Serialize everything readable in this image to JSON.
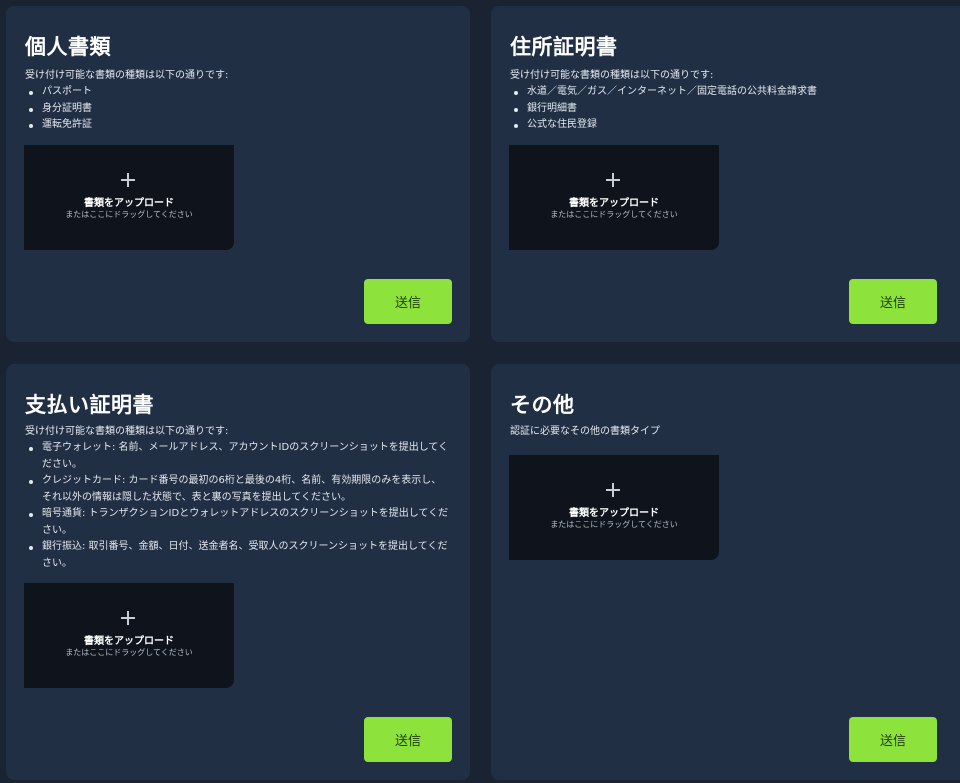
{
  "cards": {
    "personal": {
      "title": "個人書類",
      "description": "受け付け可能な書類の種類は以下の通りです:",
      "items": [
        "パスポート",
        "身分証明書",
        "運転免許証"
      ]
    },
    "address": {
      "title": "住所証明書",
      "description": "受け付け可能な書類の種類は以下の通りです:",
      "items": [
        "水道／電気／ガス／インターネット／固定電話の公共料金請求書",
        "銀行明細書",
        "公式な住民登録"
      ]
    },
    "payment": {
      "title": "支払い証明書",
      "description": "受け付け可能な書類の種類は以下の通りです:",
      "items": [
        "電子ウォレット: 名前、メールアドレス、アカウントIDのスクリーンショットを提出してください。",
        "クレジットカード: カード番号の最初の6桁と最後の4桁、名前、有効期限のみを表示し、それ以外の情報は隠した状態で、表と裏の写真を提出してください。",
        "暗号通貨: トランザクションIDとウォレットアドレスのスクリーンショットを提出してください。",
        "銀行振込: 取引番号、金額、日付、送金者名、受取人のスクリーンショットを提出してください。"
      ]
    },
    "other": {
      "title": "その他",
      "description": "認証に必要なその他の書類タイプ"
    }
  },
  "upload": {
    "label": "書類をアップロード",
    "hint": "またはここにドラッグしてください",
    "icon": "plus-icon"
  },
  "submit_label": "送信",
  "colors": {
    "background": "#1a2332",
    "card": "#212f44",
    "dropzone": "#0e131c",
    "accent": "#8de23c"
  }
}
